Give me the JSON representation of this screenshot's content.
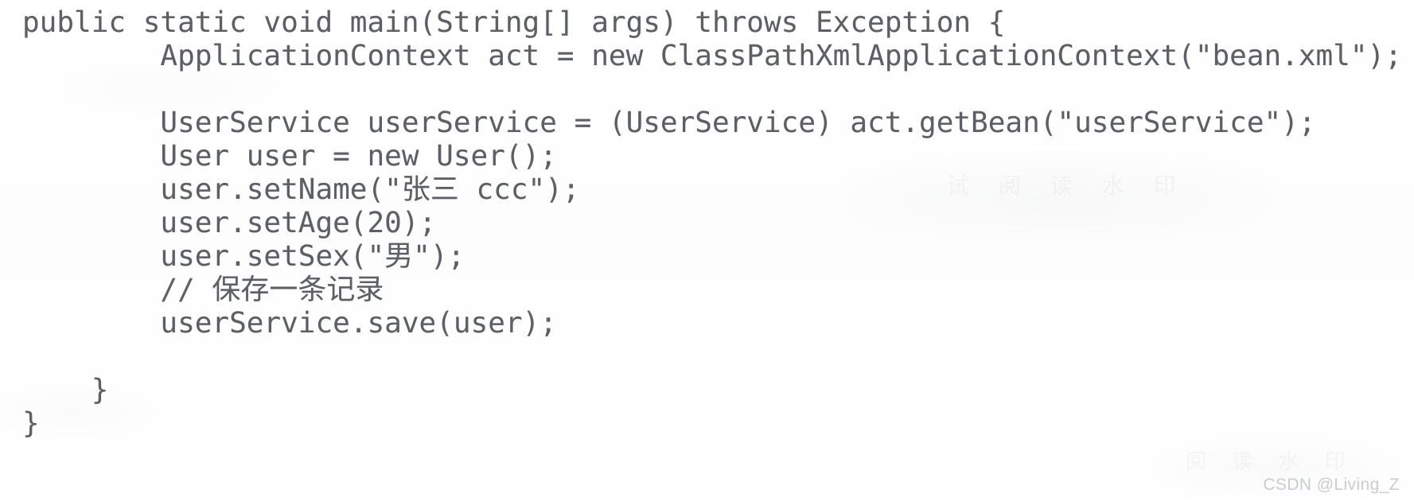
{
  "document": {
    "kind": "code-snippet",
    "language": "Java",
    "text_color": "#5c6066",
    "background_color": "#ffffff"
  },
  "code": {
    "lines": [
      "public static void main(String[] args) throws Exception {",
      "        ApplicationContext act = new ClassPathXmlApplicationContext(\"bean.xml\");",
      "",
      "        UserService userService = (UserService) act.getBean(\"userService\");",
      "        User user = new User();",
      "        user.setName(\"张三 ccc\");",
      "        user.setAge(20);",
      "        user.setSex(\"男\");",
      "        // 保存一条记录",
      "        userService.save(user);",
      "",
      "    }",
      "}"
    ]
  },
  "watermark": {
    "text": "CSDN @Living_Z",
    "color": "#c9ccd1"
  },
  "ghost_marks": {
    "a": "试 阅 读 水 印",
    "b": "阅 读 水 印"
  }
}
